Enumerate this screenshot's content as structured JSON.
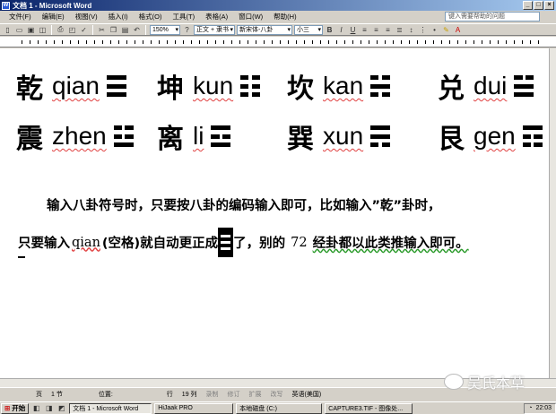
{
  "window": {
    "title": "文档 1 - Microsoft Word",
    "icon_letter": "W"
  },
  "menu": [
    "文件(F)",
    "编辑(E)",
    "视图(V)",
    "插入(I)",
    "格式(O)",
    "工具(T)",
    "表格(A)",
    "窗口(W)",
    "帮助(H)"
  ],
  "help_box": {
    "placeholder": "键入需要帮助的问题"
  },
  "toolbar": {
    "zoom": "150%",
    "style": "正文 + 隶书",
    "font": "新宋体-八卦",
    "size": "小三",
    "bold": "B",
    "italic": "I",
    "underline": "U"
  },
  "hexagrams": [
    {
      "han": "乾",
      "pinyin": "qian",
      "lines": [
        "solid",
        "solid",
        "solid"
      ]
    },
    {
      "han": "坤",
      "pinyin": "kun",
      "lines": [
        "broken",
        "broken",
        "broken"
      ]
    },
    {
      "han": "坎",
      "pinyin": "kan",
      "lines": [
        "broken",
        "solid",
        "broken"
      ]
    },
    {
      "han": "兑",
      "pinyin": "dui",
      "lines": [
        "broken",
        "solid",
        "solid"
      ]
    },
    {
      "han": "震",
      "pinyin": "zhen",
      "lines": [
        "broken",
        "broken",
        "solid"
      ]
    },
    {
      "han": "离",
      "pinyin": "li",
      "lines": [
        "solid",
        "broken",
        "solid"
      ]
    },
    {
      "han": "巽",
      "pinyin": "xun",
      "lines": [
        "solid",
        "solid",
        "broken"
      ]
    },
    {
      "han": "艮",
      "pinyin": "gen",
      "lines": [
        "solid",
        "broken",
        "broken"
      ]
    }
  ],
  "paragraph": {
    "line1": "输入八卦符号时，只要按八卦的编码输入即可，比如输入”乾”卦时，",
    "line2_a": "只要输入",
    "line2_code": "qian",
    "line2_b": "(空格)就自动更正成",
    "line2_c": "了，别的",
    "line2_num": "72",
    "line2_d": "经卦都以此类推输入即可。"
  },
  "status": {
    "page": "页",
    "section": "1 节",
    "position": "位置:",
    "line": "行",
    "col": "19 列",
    "rec": "录制",
    "trk": "修订",
    "ext": "扩展",
    "ovr": "改写",
    "lang": "英语(美国)"
  },
  "taskbar": {
    "start": "开始",
    "tasks": [
      "文档 1 - Microsoft Word",
      "HiJaak PRO",
      "本地磁盘 (C:)",
      "CAPTURE3.TIF - 图像处..."
    ],
    "clock": "22:03"
  },
  "watermark": "吴氏本草"
}
